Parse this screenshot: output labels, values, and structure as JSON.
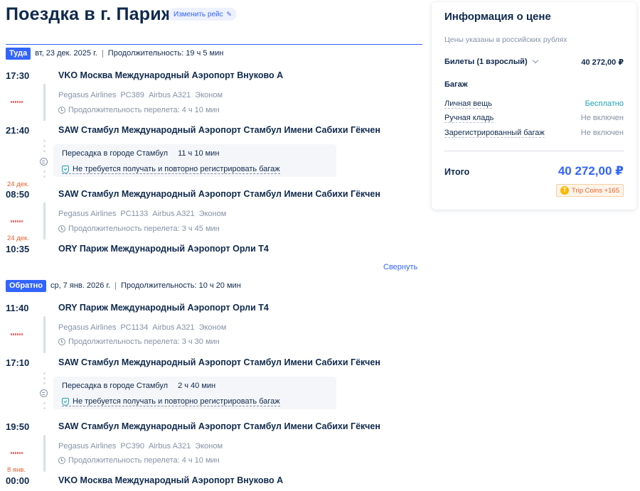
{
  "header": {
    "title": "Поездка в г. Париж",
    "change_label": "Изменить рейс"
  },
  "outbound": {
    "badge": "Туда",
    "date": "вт, 23 дек. 2025 г.",
    "duration": "Продолжительность: 19 ч 5 мин",
    "dep1_time": "17:30",
    "dep1_airport": "VKO Москва Международный Аэропорт Внуково A",
    "seg1_airline": "Pegasus Airlines",
    "seg1_flight": "PC389",
    "seg1_aircraft": "Airbus A321",
    "seg1_class": "Эконом",
    "seg1_duration": "Продолжительность перелета: 4 ч 10 мин",
    "arr1_time": "21:40",
    "arr1_airport": "SAW Стамбул Международный Аэропорт Стамбул Имени Сабихи Гёкчен",
    "transfer_city": "Пересадка в городе Стамбул",
    "transfer_duration": "11 ч 10 мин",
    "transfer_note": "Не требуется получать и повторно регистрировать багаж",
    "dep2_date": "24 дек.",
    "dep2_time": "08:50",
    "dep2_airport": "SAW Стамбул Международный Аэропорт Стамбул Имени Сабихи Гёкчен",
    "seg2_airline": "Pegasus Airlines",
    "seg2_flight": "PC1133",
    "seg2_aircraft": "Airbus A321",
    "seg2_class": "Эконом",
    "seg2_duration": "Продолжительность перелета: 3 ч 45 мин",
    "arr2_date": "24 дек.",
    "arr2_time": "10:35",
    "arr2_airport": "ORY Париж Международный Аэропорт Орли T4",
    "collapse_label": "Свернуть"
  },
  "return": {
    "badge": "Обратно",
    "date": "ср, 7 янв. 2026 г.",
    "duration": "Продолжительность: 10 ч 20 мин",
    "dep1_time": "11:40",
    "dep1_airport": "ORY Париж Международный Аэропорт Орли T4",
    "seg1_airline": "Pegasus Airlines",
    "seg1_flight": "PC1134",
    "seg1_aircraft": "Airbus A321",
    "seg1_class": "Эконом",
    "seg1_duration": "Продолжительность перелета: 3 ч 30 мин",
    "arr1_time": "17:10",
    "arr1_airport": "SAW Стамбул Международный Аэропорт Стамбул Имени Сабихи Гёкчен",
    "transfer_city": "Пересадка в городе Стамбул",
    "transfer_duration": "2 ч 40 мин",
    "transfer_note": "Не требуется получать и повторно регистрировать багаж",
    "dep2_time": "19:50",
    "dep2_airport": "SAW Стамбул Международный Аэропорт Стамбул Имени Сабихи Гёкчен",
    "seg2_airline": "Pegasus Airlines",
    "seg2_flight": "PC390",
    "seg2_aircraft": "Airbus A321",
    "seg2_class": "Эконом",
    "seg2_duration": "Продолжительность перелета: 4 ч 10 мин",
    "arr2_date": "8 янв.",
    "arr2_time": "00:00",
    "arr2_airport": "VKO Москва Международный Аэропорт Внуково A"
  },
  "price": {
    "title": "Информация о цене",
    "subtitle": "Цены указаны в российских рублях",
    "tickets_label": "Билеты (1 взрослый)",
    "tickets_value": "40 272,00 ₽",
    "baggage_heading": "Багаж",
    "personal_item_label": "Личная вещь",
    "personal_item_value": "Бесплатно",
    "carry_on_label": "Ручная кладь",
    "carry_on_value": "Не включен",
    "checked_label": "Зарегистрированный багаж",
    "checked_value": "Не включен",
    "total_label": "Итого",
    "total_value": "40 272,00 ₽",
    "coins_label": "Trip Coins +165",
    "coin_glyph": "T"
  },
  "colors": {
    "accent": "#3264ff",
    "text": "#0f294d",
    "muted": "#8592a6",
    "orange": "#e3612f",
    "teal": "#1da3b2"
  }
}
